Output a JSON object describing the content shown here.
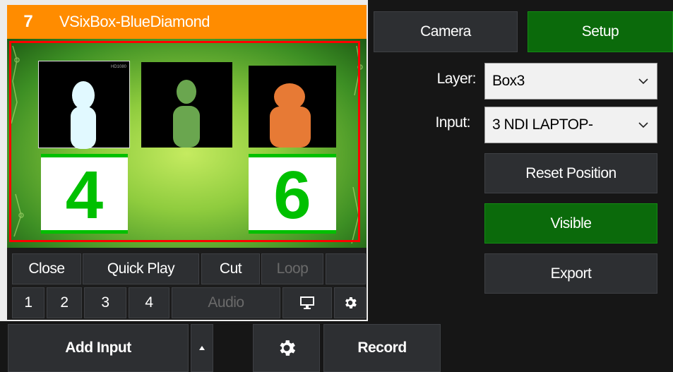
{
  "input": {
    "number": "7",
    "title": "VSixBox-BlueDiamond",
    "preview": {
      "number_left": "4",
      "number_right": "6",
      "res_label": "HD1080"
    }
  },
  "controls": {
    "row1": [
      "Close",
      "Quick Play",
      "Cut",
      "Loop"
    ],
    "row2": [
      "1",
      "2",
      "3",
      "4",
      "Audio"
    ]
  },
  "right": {
    "tabs": [
      "Camera",
      "Setup"
    ],
    "layer_label": "Layer:",
    "layer_value": "Box3",
    "input_label": "Input:",
    "input_value": "3 NDI LAPTOP-",
    "reset": "Reset Position",
    "visible": "Visible",
    "export": "Export"
  },
  "bottom": {
    "add_input": "Add Input",
    "record": "Record"
  },
  "colors": {
    "header_orange": "#ff8c00",
    "active_green": "#0b6a0b",
    "highlight_red": "#ff0000",
    "number_green": "#00c000"
  },
  "icons": [
    "monitor-icon",
    "gear-icon",
    "chevron-down-icon",
    "caret-up-icon"
  ]
}
